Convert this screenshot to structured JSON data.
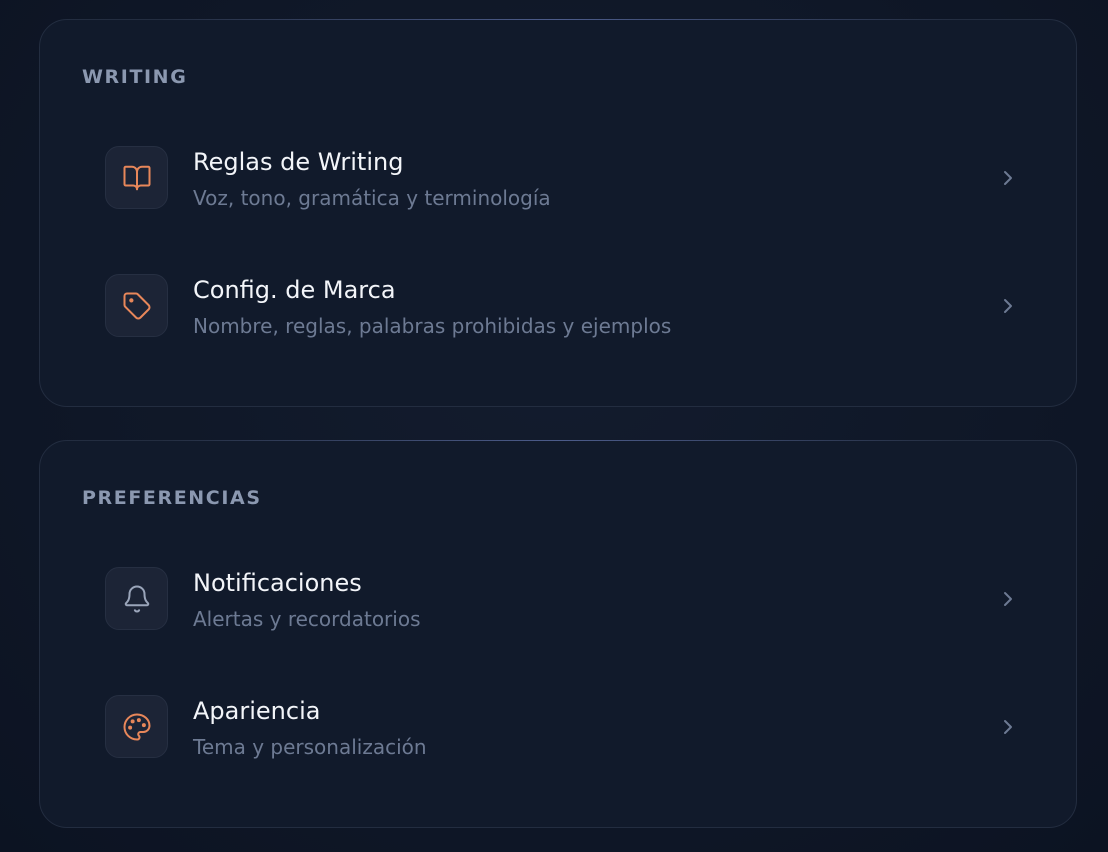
{
  "colors": {
    "accent": "#e8875a",
    "muted_icon": "#9aa5ba",
    "card_background": "#111a2b",
    "page_background": "#0f1727"
  },
  "sections": [
    {
      "title": "WRITING",
      "items": [
        {
          "icon": "book-open-icon",
          "title": "Reglas de Writing",
          "subtitle": "Voz, tono, gramática y terminología"
        },
        {
          "icon": "tag-icon",
          "title": "Config. de Marca",
          "subtitle": "Nombre, reglas, palabras prohibidas y ejemplos"
        }
      ]
    },
    {
      "title": "PREFERENCIAS",
      "items": [
        {
          "icon": "bell-icon",
          "title": "Notificaciones",
          "subtitle": "Alertas y recordatorios"
        },
        {
          "icon": "palette-icon",
          "title": "Apariencia",
          "subtitle": "Tema y personalización"
        }
      ]
    }
  ]
}
